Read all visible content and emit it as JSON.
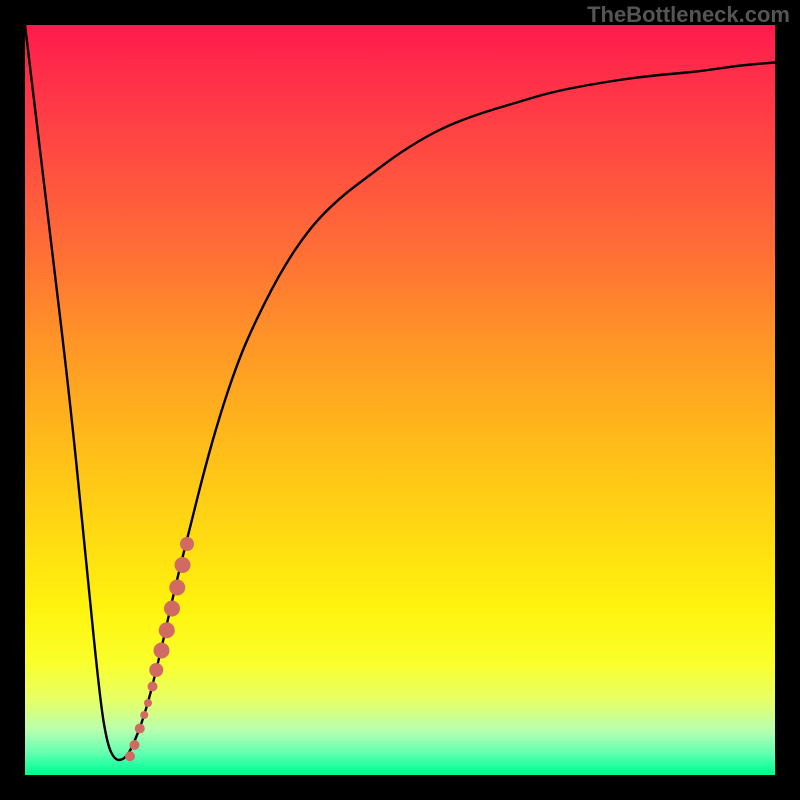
{
  "watermark": "TheBottleneck.com",
  "chart_data": {
    "type": "line",
    "title": "",
    "xlabel": "",
    "ylabel": "",
    "xlim": [
      0,
      100
    ],
    "ylim": [
      0,
      100
    ],
    "grid": false,
    "curve": {
      "x": [
        0,
        3,
        6,
        8,
        10,
        11,
        12,
        13,
        14,
        16,
        18,
        20,
        22,
        24,
        26,
        28,
        30,
        34,
        38,
        42,
        46,
        50,
        55,
        60,
        65,
        70,
        75,
        80,
        85,
        90,
        95,
        100
      ],
      "y": [
        100,
        75,
        50,
        30,
        10,
        4,
        2,
        2,
        3,
        8,
        16,
        25,
        33,
        41,
        48,
        54,
        59,
        67,
        73,
        77,
        80,
        83,
        86,
        88,
        89.5,
        91,
        92,
        92.8,
        93.4,
        93.8,
        94.6,
        95
      ]
    },
    "markers": {
      "color": "#d16a63",
      "points": [
        {
          "x": 14.0,
          "y": 2.5,
          "r": 5
        },
        {
          "x": 14.6,
          "y": 4.0,
          "r": 5
        },
        {
          "x": 15.3,
          "y": 6.2,
          "r": 5
        },
        {
          "x": 15.9,
          "y": 8.0,
          "r": 4
        },
        {
          "x": 16.4,
          "y": 9.6,
          "r": 4
        },
        {
          "x": 17.0,
          "y": 11.8,
          "r": 5
        },
        {
          "x": 17.5,
          "y": 14.0,
          "r": 7
        },
        {
          "x": 18.2,
          "y": 16.6,
          "r": 8
        },
        {
          "x": 18.9,
          "y": 19.3,
          "r": 8
        },
        {
          "x": 19.6,
          "y": 22.2,
          "r": 8
        },
        {
          "x": 20.3,
          "y": 25.0,
          "r": 8
        },
        {
          "x": 21.0,
          "y": 28.0,
          "r": 8
        },
        {
          "x": 21.6,
          "y": 30.8,
          "r": 7
        }
      ]
    },
    "gradient_stops": [
      {
        "pos": 0.0,
        "color": "#ff1a4d"
      },
      {
        "pos": 0.07,
        "color": "#ff2f49"
      },
      {
        "pos": 0.17,
        "color": "#ff4a42"
      },
      {
        "pos": 0.3,
        "color": "#ff6e36"
      },
      {
        "pos": 0.42,
        "color": "#ff9427"
      },
      {
        "pos": 0.55,
        "color": "#ffb91a"
      },
      {
        "pos": 0.68,
        "color": "#ffda12"
      },
      {
        "pos": 0.78,
        "color": "#fff40e"
      },
      {
        "pos": 0.85,
        "color": "#faff2b"
      },
      {
        "pos": 0.9,
        "color": "#e6ff66"
      },
      {
        "pos": 0.94,
        "color": "#b8ffb0"
      },
      {
        "pos": 0.97,
        "color": "#66ffb1"
      },
      {
        "pos": 0.99,
        "color": "#1aff9e"
      },
      {
        "pos": 1.0,
        "color": "#00ff88"
      }
    ]
  }
}
